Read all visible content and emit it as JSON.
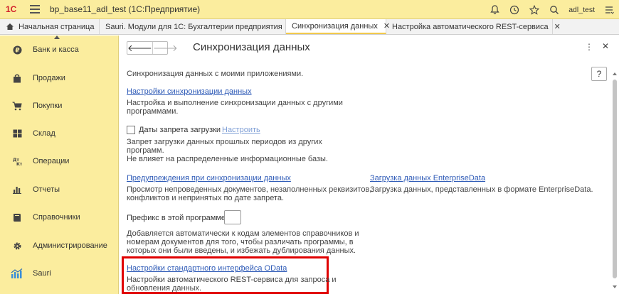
{
  "app": {
    "title": "bp_base11_adl_test  (1С:Предприятие)",
    "user": "adl_test",
    "logo": "1С"
  },
  "tabs": [
    {
      "label": "Начальная страница"
    },
    {
      "label": "Sauri. Модули для 1С: Бухгалтерии предприятия"
    },
    {
      "label": "Синхронизация данных"
    },
    {
      "label": "Настройка автоматического REST-сервиса"
    }
  ],
  "sidebar": {
    "items": [
      {
        "label": "Банк и касса",
        "icon": "ruble-coin-icon"
      },
      {
        "label": "Продажи",
        "icon": "shopping-bag-icon"
      },
      {
        "label": "Покупки",
        "icon": "cart-icon"
      },
      {
        "label": "Склад",
        "icon": "warehouse-grid-icon"
      },
      {
        "label": "Операции",
        "icon": "operations-dt-kt-icon"
      },
      {
        "label": "Отчеты",
        "icon": "bar-chart-icon"
      },
      {
        "label": "Справочники",
        "icon": "book-icon"
      },
      {
        "label": "Администрирование",
        "icon": "gear-icon"
      },
      {
        "label": "Sauri",
        "icon": "sauri-chart-icon"
      }
    ]
  },
  "page": {
    "title": "Синхронизация данных",
    "help_label": "?",
    "intro": "Синхронизация данных с моими приложениями.",
    "sync_settings": {
      "link": "Настройки синхронизации данных",
      "desc_lines": [
        "Настройка и выполнение синхронизации данных с другими",
        "программами."
      ]
    },
    "load_ban": {
      "checkbox_label": "Даты запрета загрузки",
      "configure_link": "Настроить",
      "desc_lines": [
        "Запрет загрузки данных прошлых периодов из других",
        "программ.",
        "Не влияет на распределенные информационные базы."
      ]
    },
    "warnings": {
      "link": "Предупреждения при синхронизации данных",
      "desc_lines": [
        "Просмотр непроведенных документов, незаполненных реквизитов,",
        "конфликтов и непринятых по дате запрета."
      ]
    },
    "enterprise_data": {
      "link": "Загрузка данных EnterpriseData",
      "desc": "Загрузка данных, представленных в формате EnterpriseData."
    },
    "prefix": {
      "label": "Префикс в этой программе:",
      "value": "",
      "desc_lines": [
        "Добавляется автоматически к кодам элементов справочников и",
        "номерам документов для того, чтобы различать программы, в",
        "которых они были введены, и избежать дублирования данных."
      ]
    },
    "odata": {
      "link": "Настройки стандартного интерфейса OData",
      "desc_lines": [
        "Настройки автоматического REST-сервиса для запроса и",
        "обновления данных."
      ]
    }
  },
  "colors": {
    "panel_bg": "#fbed9e",
    "link": "#2f5bb7",
    "highlight": "#e00000"
  }
}
